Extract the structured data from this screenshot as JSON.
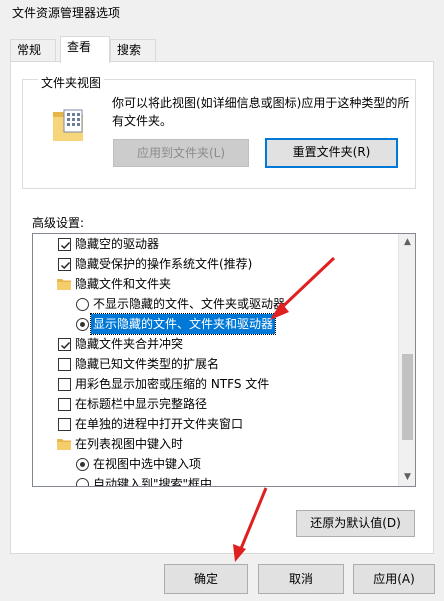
{
  "window": {
    "title": "文件资源管理器选项"
  },
  "tabs": [
    {
      "label": "常规",
      "active": false
    },
    {
      "label": "查看",
      "active": true
    },
    {
      "label": "搜索",
      "active": false
    }
  ],
  "folder_views": {
    "legend": "文件夹视图",
    "description": "你可以将此视图(如详细信息或图标)应用于这种类型的所有文件夹。",
    "apply_button": "应用到文件夹(L)",
    "reset_button": "重置文件夹(R)"
  },
  "advanced": {
    "label": "高级设置:",
    "items": [
      {
        "type": "checkbox",
        "checked": true,
        "label": "隐藏空的驱动器"
      },
      {
        "type": "checkbox",
        "checked": true,
        "label": "隐藏受保护的操作系统文件(推荐)"
      },
      {
        "type": "folder",
        "label": "隐藏文件和文件夹"
      },
      {
        "type": "radio",
        "checked": false,
        "label": "不显示隐藏的文件、文件夹或驱动器"
      },
      {
        "type": "radio",
        "checked": true,
        "label": "显示隐藏的文件、文件夹和驱动器",
        "selected": true
      },
      {
        "type": "checkbox",
        "checked": true,
        "label": "隐藏文件夹合并冲突"
      },
      {
        "type": "checkbox",
        "checked": false,
        "label": "隐藏已知文件类型的扩展名"
      },
      {
        "type": "checkbox",
        "checked": false,
        "label": "用彩色显示加密或压缩的 NTFS 文件"
      },
      {
        "type": "checkbox",
        "checked": false,
        "label": "在标题栏中显示完整路径"
      },
      {
        "type": "checkbox",
        "checked": false,
        "label": "在单独的进程中打开文件夹窗口"
      },
      {
        "type": "folder",
        "label": "在列表视图中键入时"
      },
      {
        "type": "radio",
        "checked": true,
        "label": "在视图中选中键入项"
      },
      {
        "type": "radio",
        "checked": false,
        "label": "自动键入到\"搜索\"框中"
      }
    ],
    "restore_button": "还原为默认值(D)"
  },
  "footer": {
    "ok_button": "确定",
    "cancel_button": "取消",
    "apply_button": "应用(A)"
  },
  "colors": {
    "selection": "#0078d7",
    "annotation_arrow": "#e02020",
    "folder_icon": "#f5cd6b"
  }
}
